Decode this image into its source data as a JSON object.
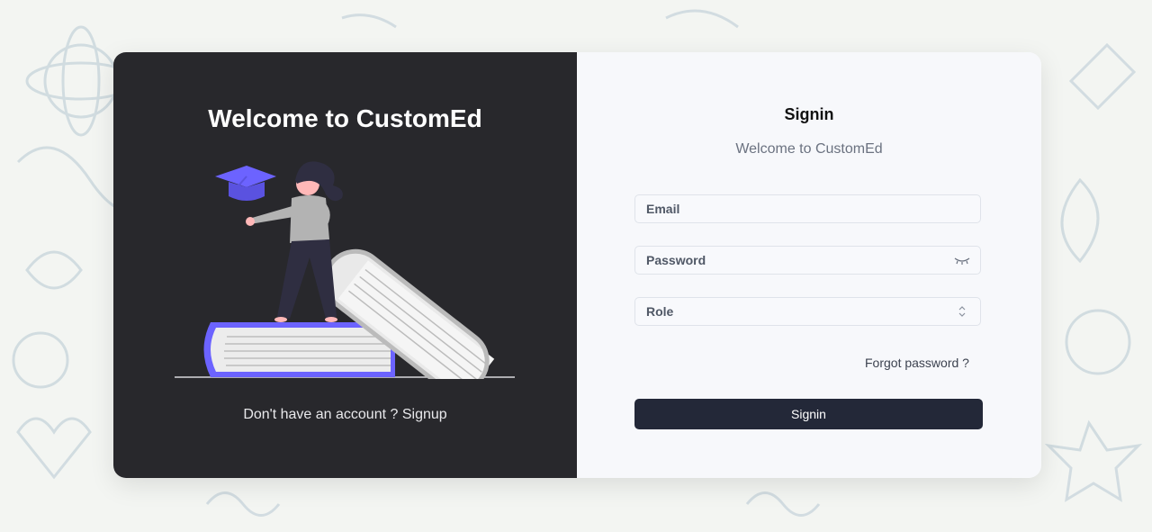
{
  "left_panel": {
    "heading": "Welcome to CustomEd",
    "signup_text": "Don't have an account ? Signup"
  },
  "right_panel": {
    "title": "Signin",
    "subtitle": "Welcome to CustomEd",
    "email_placeholder": "Email",
    "password_placeholder": "Password",
    "role_placeholder": "Role",
    "forgot_link": "Forgot password ?",
    "signin_button": "Signin"
  },
  "icons": {
    "password_toggle": "eye-closed-icon",
    "role_select": "chevron-up-down-icon"
  },
  "colors": {
    "left_bg": "#28282c",
    "right_bg": "#f7f8fb",
    "button_bg": "#232838",
    "accent": "#6c63ff"
  }
}
